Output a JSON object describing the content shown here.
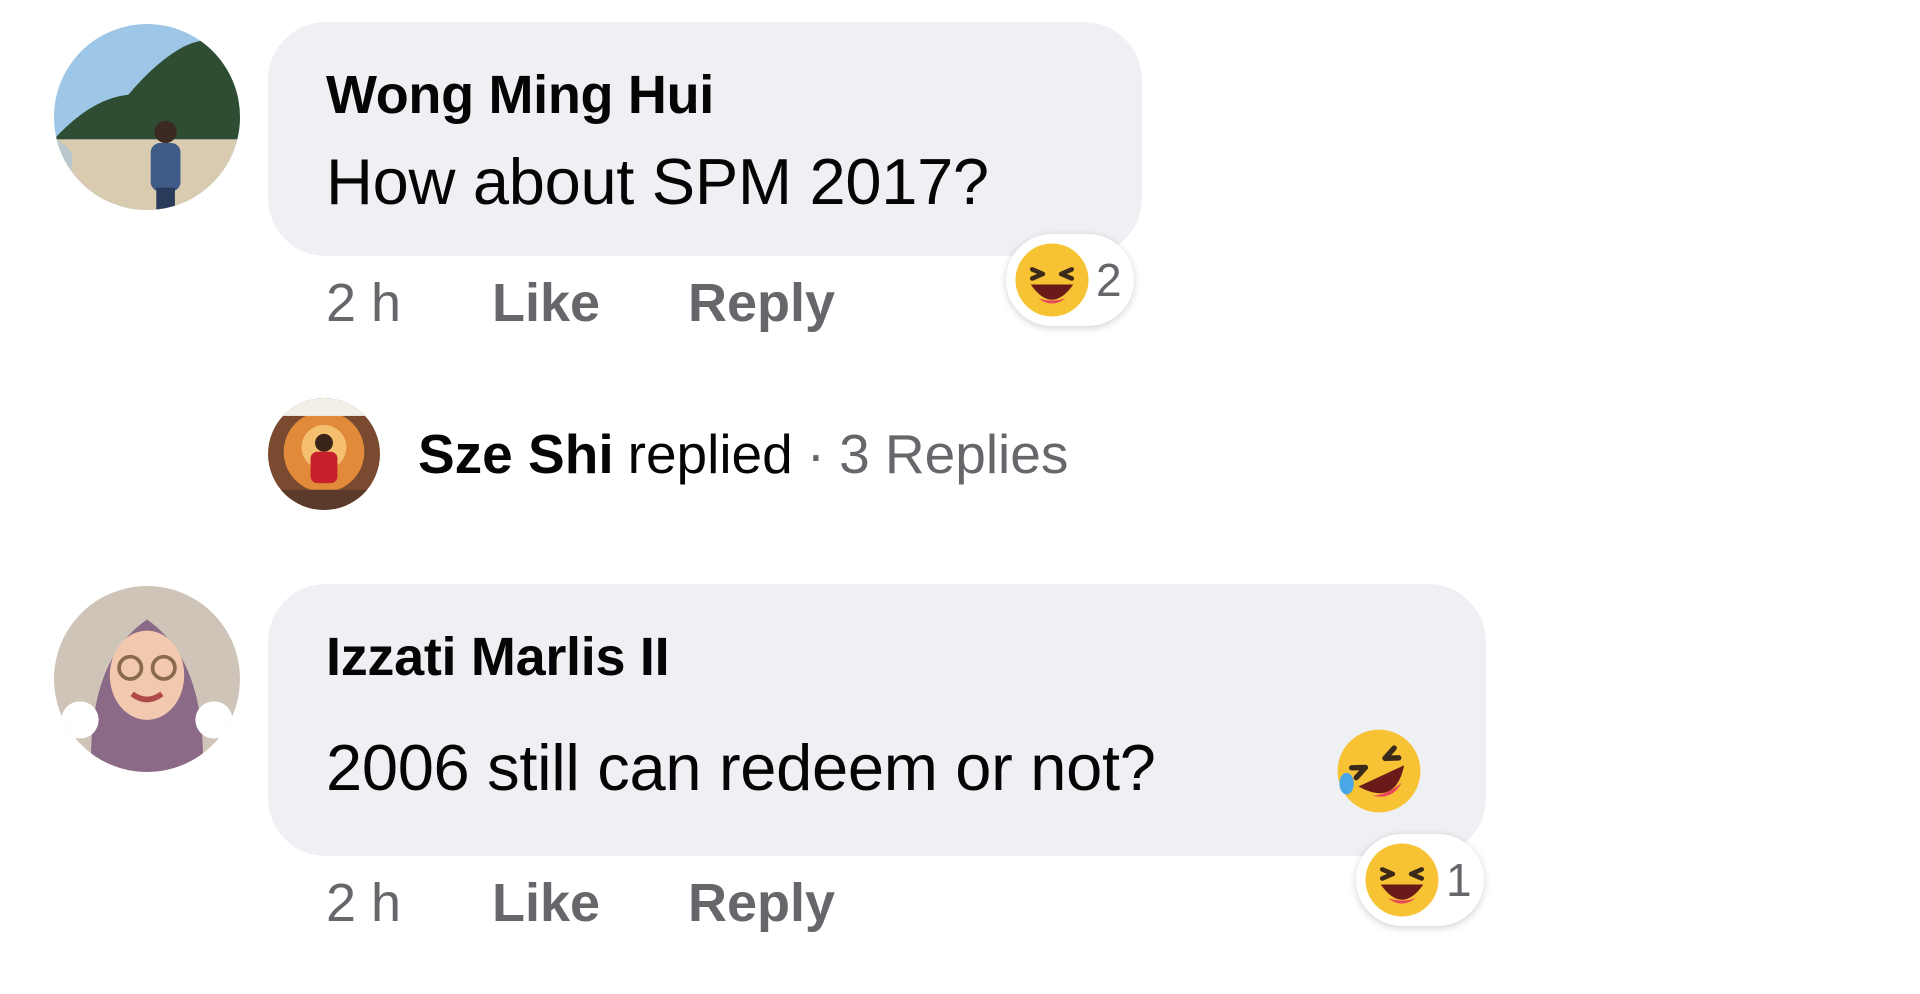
{
  "comments": [
    {
      "author": "Wong Ming Hui",
      "text": "How about SPM 2017?",
      "time": "2 h",
      "like_label": "Like",
      "reply_label": "Reply",
      "reaction": {
        "icon": "laughing-face-icon",
        "count": "2"
      }
    },
    {
      "author": "Izzati Marlis II",
      "text": "2006 still can redeem or not?",
      "inline_emoji": "rofl-emoji-icon",
      "time": "2 h",
      "like_label": "Like",
      "reply_label": "Reply",
      "reaction": {
        "icon": "laughing-face-icon",
        "count": "1"
      }
    }
  ],
  "replies_summary": {
    "name": "Sze Shi",
    "verb": "replied",
    "separator": "·",
    "count_label": "3 Replies"
  },
  "colors": {
    "bubble": "#eff0f4",
    "text": "#050505",
    "secondary": "#65676b"
  }
}
